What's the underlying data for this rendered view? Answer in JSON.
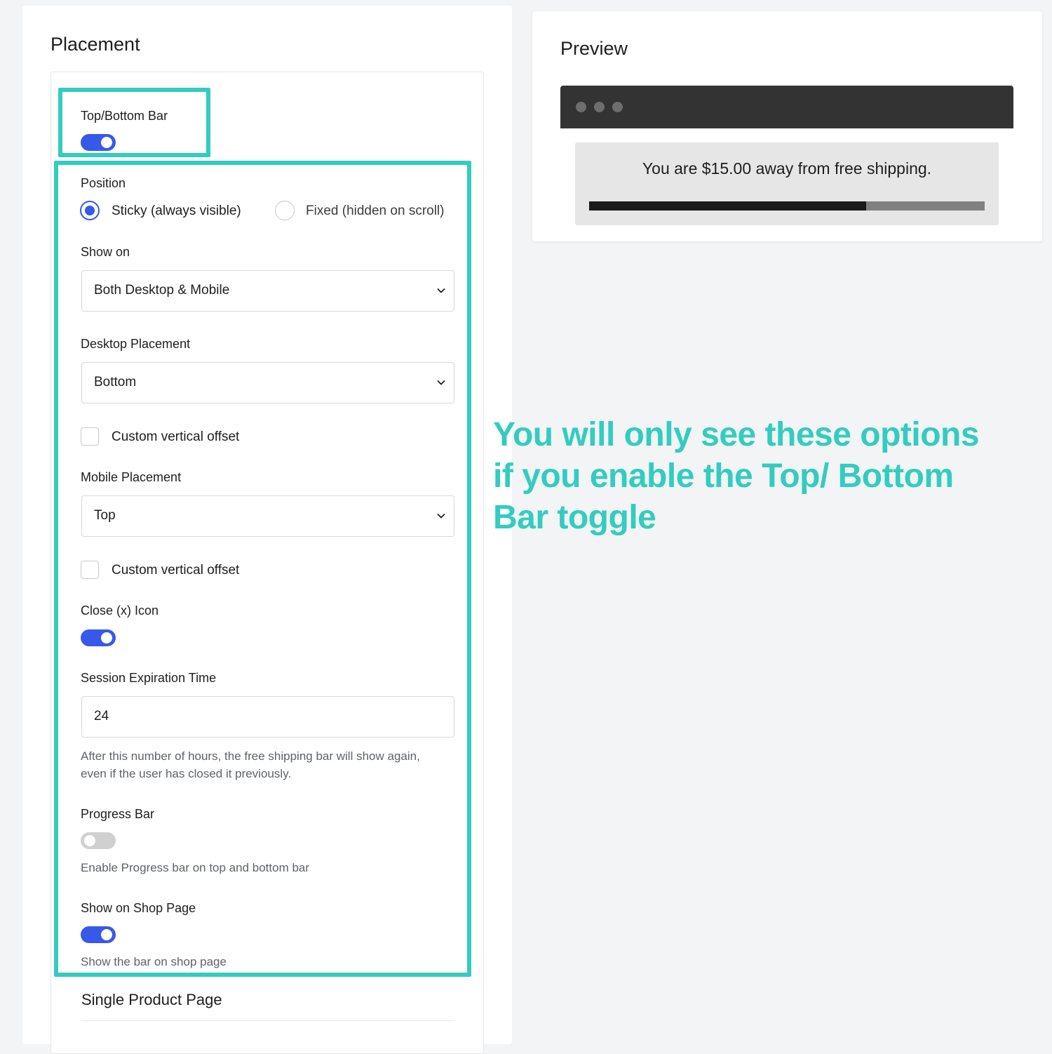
{
  "placement": {
    "title": "Placement",
    "top_bottom_bar": {
      "label": "Top/Bottom Bar",
      "enabled": true
    },
    "position": {
      "label": "Position",
      "options": [
        "Sticky (always visible)",
        "Fixed (hidden on scroll)"
      ],
      "selected": "Sticky (always visible)"
    },
    "show_on": {
      "label": "Show on",
      "value": "Both Desktop & Mobile"
    },
    "desktop_placement": {
      "label": "Desktop Placement",
      "value": "Bottom",
      "offset_label": "Custom vertical offset",
      "offset_checked": false
    },
    "mobile_placement": {
      "label": "Mobile Placement",
      "value": "Top",
      "offset_label": "Custom vertical offset",
      "offset_checked": false
    },
    "close_icon": {
      "label": "Close (x) Icon",
      "enabled": true
    },
    "session_expiration": {
      "label": "Session Expiration Time",
      "value": "24",
      "help": "After this number of hours, the free shipping bar will show again, even if the user has closed it previously."
    },
    "progress_bar": {
      "label": "Progress Bar",
      "enabled": false,
      "help": "Enable Progress bar on top and bottom bar"
    },
    "shop_page": {
      "label": "Show on Shop Page",
      "enabled": true,
      "help": "Show the bar on shop page"
    },
    "next_section": "Single Product Page"
  },
  "preview": {
    "title": "Preview",
    "message": "You are $15.00 away from free shipping.",
    "progress_fraction": 0.7
  },
  "annotation": {
    "text": "You will only see these options if you enable the Top/ Bottom Bar toggle",
    "color": "#33ccbf"
  },
  "colors": {
    "accent": "#3858e9",
    "highlight": "#33ccbf",
    "browser_bar": "#333333"
  }
}
